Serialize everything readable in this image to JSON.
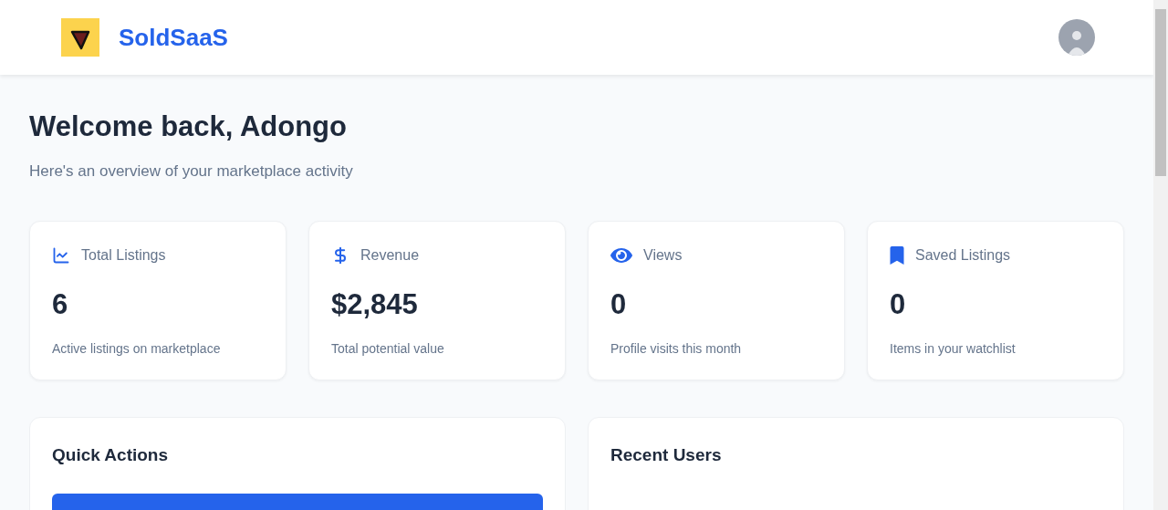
{
  "header": {
    "brand": "SoldSaaS"
  },
  "welcome": {
    "title": "Welcome back, Adongo",
    "subtitle": "Here's an overview of your marketplace activity"
  },
  "stats": [
    {
      "kind": "listings",
      "label": "Total Listings",
      "value": "6",
      "caption": "Active listings on marketplace"
    },
    {
      "kind": "revenue",
      "label": "Revenue",
      "value": "$2,845",
      "caption": "Total potential value"
    },
    {
      "kind": "views",
      "label": "Views",
      "value": "0",
      "caption": "Profile visits this month"
    },
    {
      "kind": "saved",
      "label": "Saved Listings",
      "value": "0",
      "caption": "Items in your watchlist"
    }
  ],
  "panels": [
    {
      "kind": "actions",
      "title": "Quick Actions"
    },
    {
      "kind": "users",
      "title": "Recent Users"
    }
  ]
}
